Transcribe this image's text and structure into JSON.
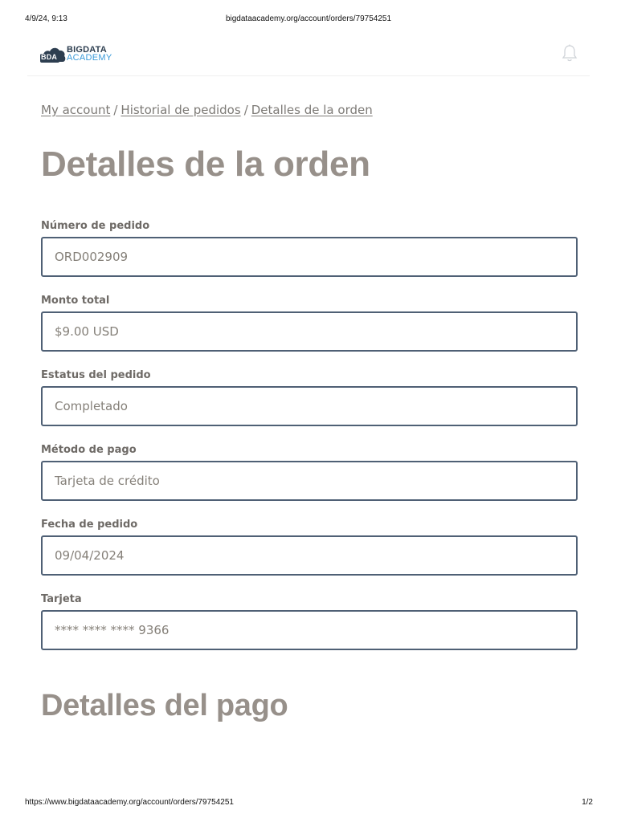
{
  "print_header": {
    "datetime": "4/9/24, 9:13",
    "url": "bigdataacademy.org/account/orders/79754251"
  },
  "logo": {
    "mark": "BDA",
    "line1": "BIGDATA",
    "line2": "ACADEMY",
    "colors": {
      "dark": "#2d3e50",
      "accent": "#3a9ad9"
    }
  },
  "header": {
    "bell_icon": "bell-icon"
  },
  "breadcrumb": {
    "items": [
      "My account",
      "Historial de pedidos",
      "Detalles de la orden"
    ],
    "separator": "/"
  },
  "page": {
    "title": "Detalles de la orden",
    "section_title": "Detalles del pago"
  },
  "fields": [
    {
      "label": "Número de pedido",
      "value": "ORD002909"
    },
    {
      "label": "Monto total",
      "value": "$9.00 USD"
    },
    {
      "label": "Estatus del pedido",
      "value": "Completado"
    },
    {
      "label": "Método de pago",
      "value": "Tarjeta de crédito"
    },
    {
      "label": "Fecha de pedido",
      "value": "09/04/2024"
    },
    {
      "label": "Tarjeta",
      "value": "**** **** **** 9366"
    }
  ],
  "print_footer": {
    "url": "https://www.bigdataacademy.org/account/orders/79754251",
    "page": "1/2"
  },
  "colors": {
    "title": "#97908a",
    "field_border": "#4f6075",
    "field_text": "#858079",
    "label": "#6e6a66"
  }
}
